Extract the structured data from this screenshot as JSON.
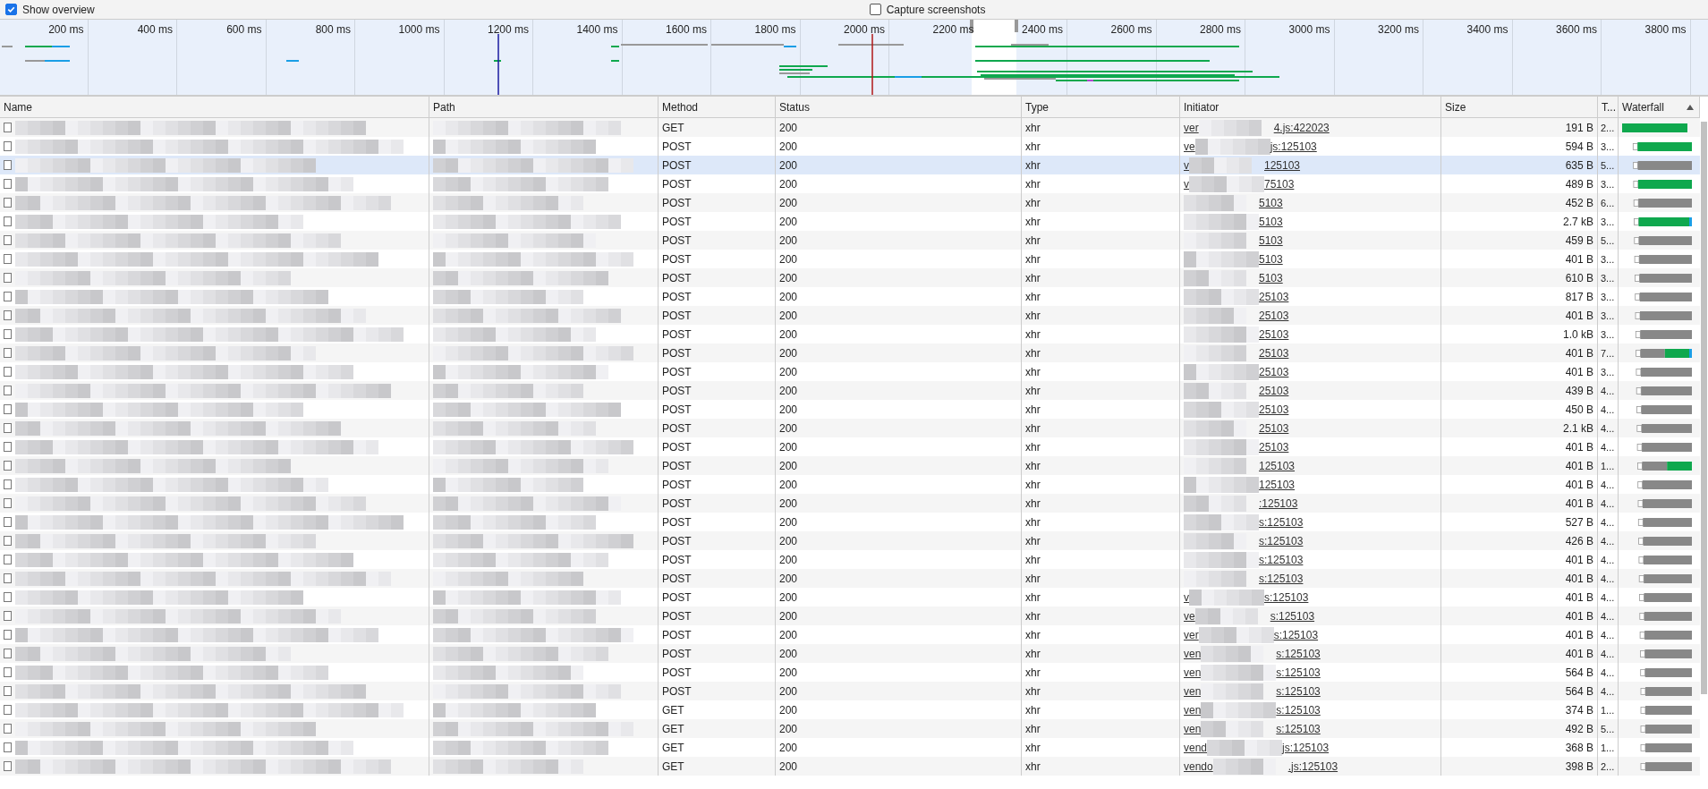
{
  "toolbar": {
    "options": [
      {
        "label": "Show overview",
        "checked": true
      },
      {
        "label": "Capture screenshots",
        "checked": false
      }
    ]
  },
  "overview": {
    "ticks": [
      "200 ms",
      "400 ms",
      "600 ms",
      "800 ms",
      "1000 ms",
      "1200 ms",
      "1400 ms",
      "1600 ms",
      "1800 ms",
      "2000 ms",
      "2200 ms",
      "2400 ms",
      "2600 ms",
      "2800 ms",
      "3000 ms",
      "3200 ms",
      "3400 ms",
      "3600 ms",
      "3800 ms"
    ]
  },
  "table": {
    "columns": [
      {
        "label": "Name"
      },
      {
        "label": "Path"
      },
      {
        "label": "Method"
      },
      {
        "label": "Status"
      },
      {
        "label": "Type"
      },
      {
        "label": "Initiator"
      },
      {
        "label": "Size"
      },
      {
        "label": "T..."
      },
      {
        "label": "Waterfall",
        "sorted": true
      }
    ],
    "rows": [
      {
        "selected": false,
        "method": "GET",
        "status": "200",
        "type": "xhr",
        "initiator_start": "ver",
        "initiator": "4.js:422023",
        "size": "191 B",
        "time": "2...",
        "waterfall": [
          {
            "kind": "download"
          }
        ]
      },
      {
        "selected": false,
        "method": "POST",
        "status": "200",
        "type": "xhr",
        "initiator_start": "ve",
        "initiator": "js:125103",
        "size": "594 B",
        "time": "3...",
        "waterfall": [
          {
            "kind": "queued"
          },
          {
            "kind": "download"
          }
        ]
      },
      {
        "selected": true,
        "method": "POST",
        "status": "200",
        "type": "xhr",
        "initiator_start": "v",
        "initiator": "125103",
        "size": "635 B",
        "time": "5...",
        "waterfall": [
          {
            "kind": "queued"
          },
          {
            "kind": "waiting"
          }
        ]
      },
      {
        "selected": false,
        "method": "POST",
        "status": "200",
        "type": "xhr",
        "initiator_start": "v",
        "initiator": "75103",
        "size": "489 B",
        "time": "3...",
        "waterfall": [
          {
            "kind": "queued"
          },
          {
            "kind": "download"
          }
        ]
      },
      {
        "selected": false,
        "method": "POST",
        "status": "200",
        "type": "xhr",
        "initiator": "5103",
        "size": "452 B",
        "time": "6...",
        "waterfall": [
          {
            "kind": "queued"
          },
          {
            "kind": "waiting"
          }
        ]
      },
      {
        "selected": false,
        "method": "POST",
        "status": "200",
        "type": "xhr",
        "initiator": "5103",
        "size": "2.7 kB",
        "time": "3...",
        "waterfall": [
          {
            "kind": "queued"
          },
          {
            "kind": "download"
          },
          {
            "kind": "receiving"
          }
        ]
      },
      {
        "selected": false,
        "method": "POST",
        "status": "200",
        "type": "xhr",
        "initiator": "5103",
        "size": "459 B",
        "time": "5...",
        "waterfall": [
          {
            "kind": "queued"
          },
          {
            "kind": "waiting"
          }
        ]
      },
      {
        "selected": false,
        "method": "POST",
        "status": "200",
        "type": "xhr",
        "initiator": "5103",
        "size": "401 B",
        "time": "3...",
        "waterfall": [
          {
            "kind": "queued"
          },
          {
            "kind": "waiting"
          }
        ]
      },
      {
        "selected": false,
        "method": "POST",
        "status": "200",
        "type": "xhr",
        "initiator": "5103",
        "size": "610 B",
        "time": "3...",
        "waterfall": [
          {
            "kind": "queued"
          },
          {
            "kind": "waiting"
          }
        ]
      },
      {
        "selected": false,
        "method": "POST",
        "status": "200",
        "type": "xhr",
        "initiator": "25103",
        "size": "817 B",
        "time": "3...",
        "waterfall": [
          {
            "kind": "queued"
          },
          {
            "kind": "waiting"
          }
        ]
      },
      {
        "selected": false,
        "method": "POST",
        "status": "200",
        "type": "xhr",
        "initiator": "25103",
        "size": "401 B",
        "time": "3...",
        "waterfall": [
          {
            "kind": "queued"
          },
          {
            "kind": "waiting"
          }
        ]
      },
      {
        "selected": false,
        "method": "POST",
        "status": "200",
        "type": "xhr",
        "initiator": "25103",
        "size": "1.0 kB",
        "time": "3...",
        "waterfall": [
          {
            "kind": "queued"
          },
          {
            "kind": "waiting"
          }
        ]
      },
      {
        "selected": false,
        "method": "POST",
        "status": "200",
        "type": "xhr",
        "initiator": "25103",
        "size": "401 B",
        "time": "7...",
        "waterfall": [
          {
            "kind": "queued"
          },
          {
            "kind": "waiting"
          },
          {
            "kind": "download"
          },
          {
            "kind": "receiving"
          }
        ]
      },
      {
        "selected": false,
        "method": "POST",
        "status": "200",
        "type": "xhr",
        "initiator": "25103",
        "size": "401 B",
        "time": "3...",
        "waterfall": [
          {
            "kind": "queued"
          },
          {
            "kind": "waiting"
          }
        ]
      },
      {
        "selected": false,
        "method": "POST",
        "status": "200",
        "type": "xhr",
        "initiator": "25103",
        "size": "439 B",
        "time": "4...",
        "waterfall": [
          {
            "kind": "queued"
          },
          {
            "kind": "waiting"
          }
        ]
      },
      {
        "selected": false,
        "method": "POST",
        "status": "200",
        "type": "xhr",
        "initiator": "25103",
        "size": "450 B",
        "time": "4...",
        "waterfall": [
          {
            "kind": "queued"
          },
          {
            "kind": "waiting"
          }
        ]
      },
      {
        "selected": false,
        "method": "POST",
        "status": "200",
        "type": "xhr",
        "initiator": "25103",
        "size": "2.1 kB",
        "time": "4...",
        "waterfall": [
          {
            "kind": "queued"
          },
          {
            "kind": "waiting"
          }
        ]
      },
      {
        "selected": false,
        "method": "POST",
        "status": "200",
        "type": "xhr",
        "initiator": "25103",
        "size": "401 B",
        "time": "4...",
        "waterfall": [
          {
            "kind": "queued"
          },
          {
            "kind": "waiting"
          }
        ]
      },
      {
        "selected": false,
        "method": "POST",
        "status": "200",
        "type": "xhr",
        "initiator": "125103",
        "size": "401 B",
        "time": "1...",
        "waterfall": [
          {
            "kind": "queued"
          },
          {
            "kind": "waiting"
          },
          {
            "kind": "download"
          }
        ]
      },
      {
        "selected": false,
        "method": "POST",
        "status": "200",
        "type": "xhr",
        "initiator": "125103",
        "size": "401 B",
        "time": "4...",
        "waterfall": [
          {
            "kind": "queued"
          },
          {
            "kind": "waiting"
          }
        ]
      },
      {
        "selected": false,
        "method": "POST",
        "status": "200",
        "type": "xhr",
        "initiator": ":125103",
        "size": "401 B",
        "time": "4...",
        "waterfall": [
          {
            "kind": "queued"
          },
          {
            "kind": "waiting"
          }
        ]
      },
      {
        "selected": false,
        "method": "POST",
        "status": "200",
        "type": "xhr",
        "initiator": "s:125103",
        "size": "527 B",
        "time": "4...",
        "waterfall": [
          {
            "kind": "queued"
          },
          {
            "kind": "waiting"
          }
        ]
      },
      {
        "selected": false,
        "method": "POST",
        "status": "200",
        "type": "xhr",
        "initiator": "s:125103",
        "size": "426 B",
        "time": "4...",
        "waterfall": [
          {
            "kind": "queued"
          },
          {
            "kind": "waiting"
          }
        ]
      },
      {
        "selected": false,
        "method": "POST",
        "status": "200",
        "type": "xhr",
        "initiator": "s:125103",
        "size": "401 B",
        "time": "4...",
        "waterfall": [
          {
            "kind": "queued"
          },
          {
            "kind": "waiting"
          }
        ]
      },
      {
        "selected": false,
        "method": "POST",
        "status": "200",
        "type": "xhr",
        "initiator": "s:125103",
        "size": "401 B",
        "time": "4...",
        "waterfall": [
          {
            "kind": "queued"
          },
          {
            "kind": "waiting"
          }
        ]
      },
      {
        "selected": false,
        "method": "POST",
        "status": "200",
        "type": "xhr",
        "initiator_start": "v",
        "initiator": "s:125103",
        "size": "401 B",
        "time": "4...",
        "waterfall": [
          {
            "kind": "queued"
          },
          {
            "kind": "waiting"
          }
        ]
      },
      {
        "selected": false,
        "method": "POST",
        "status": "200",
        "type": "xhr",
        "initiator_start": "ve",
        "initiator": "s:125103",
        "size": "401 B",
        "time": "4...",
        "waterfall": [
          {
            "kind": "queued"
          },
          {
            "kind": "waiting"
          }
        ]
      },
      {
        "selected": false,
        "method": "POST",
        "status": "200",
        "type": "xhr",
        "initiator_start": "ver",
        "initiator": "s:125103",
        "size": "401 B",
        "time": "4...",
        "waterfall": [
          {
            "kind": "queued"
          },
          {
            "kind": "waiting"
          }
        ]
      },
      {
        "selected": false,
        "method": "POST",
        "status": "200",
        "type": "xhr",
        "initiator_start": "ven",
        "initiator": "s:125103",
        "size": "401 B",
        "time": "4...",
        "waterfall": [
          {
            "kind": "queued"
          },
          {
            "kind": "waiting"
          }
        ]
      },
      {
        "selected": false,
        "method": "POST",
        "status": "200",
        "type": "xhr",
        "initiator_start": "ven",
        "initiator": "s:125103",
        "size": "564 B",
        "time": "4...",
        "waterfall": [
          {
            "kind": "queued"
          },
          {
            "kind": "waiting"
          }
        ]
      },
      {
        "selected": false,
        "method": "POST",
        "status": "200",
        "type": "xhr",
        "initiator_start": "ven",
        "initiator": "s:125103",
        "size": "564 B",
        "time": "4...",
        "waterfall": [
          {
            "kind": "queued"
          },
          {
            "kind": "waiting"
          }
        ]
      },
      {
        "selected": false,
        "method": "GET",
        "status": "200",
        "type": "xhr",
        "initiator_start": "ven",
        "initiator": "s:125103",
        "size": "374 B",
        "time": "1...",
        "waterfall": [
          {
            "kind": "queued"
          },
          {
            "kind": "waiting"
          }
        ]
      },
      {
        "selected": false,
        "method": "GET",
        "status": "200",
        "type": "xhr",
        "initiator_start": "ven",
        "initiator": "s:125103",
        "size": "492 B",
        "time": "5...",
        "waterfall": [
          {
            "kind": "queued"
          },
          {
            "kind": "waiting"
          }
        ]
      },
      {
        "selected": false,
        "method": "GET",
        "status": "200",
        "type": "xhr",
        "initiator_start": "vend",
        "initiator": "js:125103",
        "size": "368 B",
        "time": "1...",
        "waterfall": [
          {
            "kind": "queued"
          },
          {
            "kind": "waiting"
          }
        ]
      },
      {
        "selected": false,
        "method": "GET",
        "status": "200",
        "type": "xhr",
        "initiator_start": "vendo",
        "initiator": ".js:125103",
        "size": "398 B",
        "time": "2...",
        "waterfall": [
          {
            "kind": "queued"
          },
          {
            "kind": "waiting"
          }
        ]
      }
    ]
  }
}
